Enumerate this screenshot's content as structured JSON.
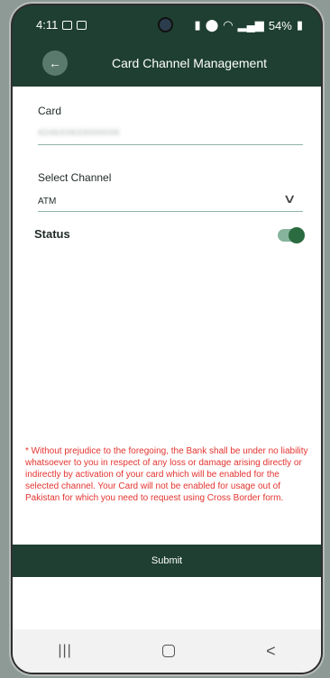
{
  "statusbar": {
    "time": "4:11",
    "battery": "54%"
  },
  "header": {
    "back_icon": "←",
    "title": "Card Channel Management"
  },
  "form": {
    "card_label": "Card",
    "card_value": "4246X0633000005",
    "channel_label": "Select Channel",
    "channel_value": "ATM",
    "chevron": "∨",
    "status_label": "Status",
    "status_on": true
  },
  "disclaimer": "* Without prejudice to the foregoing, the Bank shall be under no liability whatsoever to you in respect of any loss or damage arising directly or indirectly by activation of your card which will be enabled for the selected channel. Your Card will not be enabled for usage out of Pakistan for which you need to request using Cross Border form.",
  "submit_label": "Submit",
  "navbar": {
    "recents": "|||",
    "back": "<"
  },
  "colors": {
    "brand": "#1e3f32",
    "warning": "#e3342f",
    "toggle_knob": "#2a6b40"
  }
}
